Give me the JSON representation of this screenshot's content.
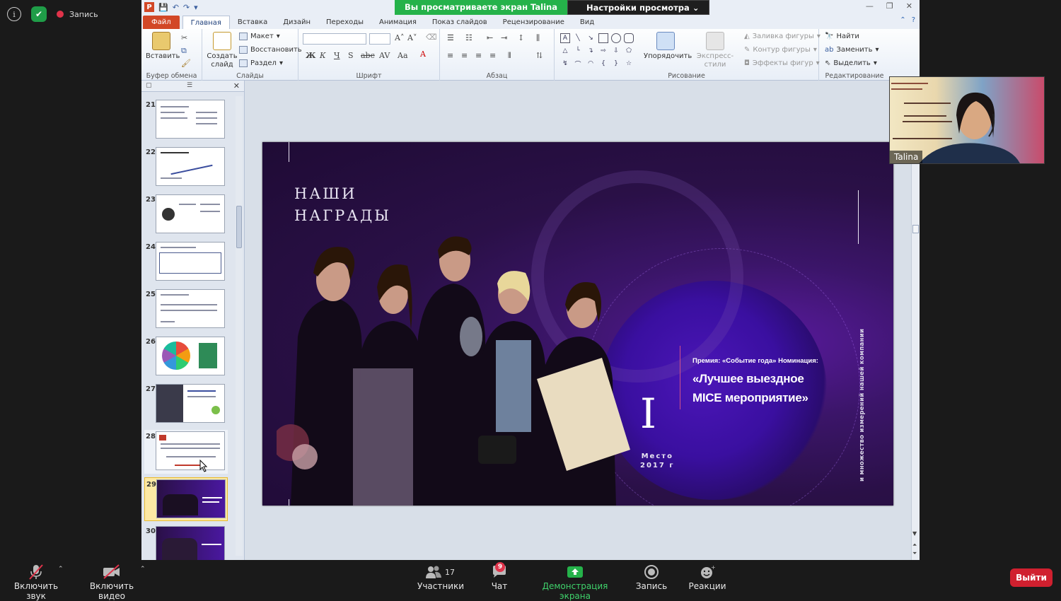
{
  "zoom": {
    "recording_label": "Запись",
    "banner_viewing": "Вы просматриваете экран Talina",
    "banner_settings": "Настройки просмотра",
    "participant_name": "Talina",
    "bottom": {
      "audio": "Включить звук",
      "video": "Включить видео",
      "participants": "Участники",
      "participants_count": "17",
      "chat": "Чат",
      "chat_badge": "9",
      "share": "Демонстрация экрана",
      "record": "Запись",
      "reactions": "Реакции",
      "leave": "Выйти"
    },
    "colors": {
      "share_green": "#25b24a",
      "leave_red": "#d0202f"
    }
  },
  "ppt": {
    "tabs": [
      "Файл",
      "Главная",
      "Вставка",
      "Дизайн",
      "Переходы",
      "Анимация",
      "Показ слайдов",
      "Рецензирование",
      "Вид"
    ],
    "ribbon": {
      "paste": "Вставить",
      "new_slide": "Создать слайд",
      "layout": "Макет",
      "reset": "Восстановить",
      "section": "Раздел",
      "arrange": "Упорядочить",
      "quick_styles": "Экспресс-стили",
      "shape_fill": "Заливка фигуры",
      "shape_outline": "Контур фигуры",
      "shape_effects": "Эффекты фигур",
      "find": "Найти",
      "replace": "Заменить",
      "select": "Выделить",
      "groups": {
        "clipboard": "Буфер обмена",
        "slides": "Слайды",
        "font": "Шрифт",
        "paragraph": "Абзац",
        "drawing": "Рисование",
        "editing": "Редактирование"
      }
    },
    "thumbnails": [
      "21",
      "22",
      "23",
      "24",
      "25",
      "26",
      "27",
      "28",
      "29",
      "30"
    ],
    "selected_slide": "29"
  },
  "slide": {
    "title_line1": "НАШИ",
    "title_line2": "НАГРАДЫ",
    "prize": "Премия: «Событие года» Номинация:",
    "award_line1": "«Лучшее выездное",
    "award_line2": "MICE мероприятие»",
    "roman": "I",
    "place": "Место",
    "year": "2017 г",
    "side_text": "и множество измерений нашей компании"
  }
}
